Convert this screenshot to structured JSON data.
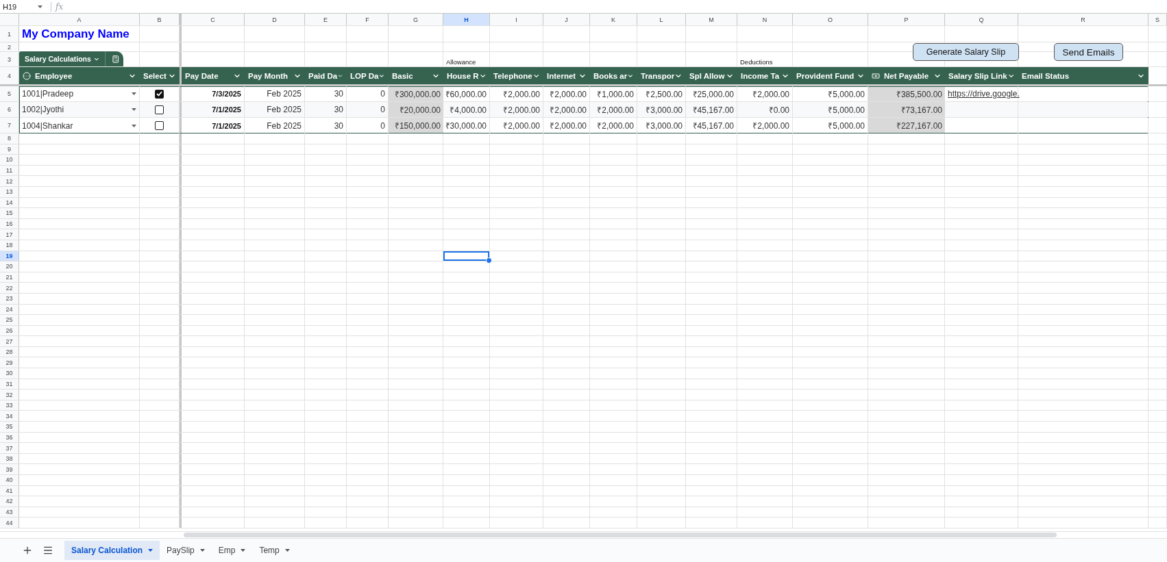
{
  "formula_bar": {
    "name_box": "H19",
    "function_label": "fx"
  },
  "column_letters": [
    {
      "letter": "A",
      "selected": false
    },
    {
      "letter": "B",
      "selected": false
    },
    {
      "letter": "C",
      "selected": false
    },
    {
      "letter": "D",
      "selected": false
    },
    {
      "letter": "E",
      "selected": false
    },
    {
      "letter": "F",
      "selected": false
    },
    {
      "letter": "G",
      "selected": false
    },
    {
      "letter": "H",
      "selected": true
    },
    {
      "letter": "I",
      "selected": false
    },
    {
      "letter": "J",
      "selected": false
    },
    {
      "letter": "K",
      "selected": false
    },
    {
      "letter": "L",
      "selected": false
    },
    {
      "letter": "M",
      "selected": false
    },
    {
      "letter": "N",
      "selected": false
    },
    {
      "letter": "O",
      "selected": false
    },
    {
      "letter": "P",
      "selected": false
    },
    {
      "letter": "Q",
      "selected": false
    },
    {
      "letter": "R",
      "selected": false
    },
    {
      "letter": "S",
      "selected": false
    }
  ],
  "row_numbers": [
    {
      "number": "1",
      "selected": false
    },
    {
      "number": "2",
      "selected": false
    },
    {
      "number": "3",
      "selected": false
    },
    {
      "number": "4",
      "selected": false
    },
    {
      "number": "5",
      "selected": false
    },
    {
      "number": "6",
      "selected": false
    },
    {
      "number": "7",
      "selected": false
    },
    {
      "number": "8",
      "selected": false
    },
    {
      "number": "9",
      "selected": false
    },
    {
      "number": "10",
      "selected": false
    },
    {
      "number": "11",
      "selected": false
    },
    {
      "number": "12",
      "selected": false
    },
    {
      "number": "13",
      "selected": false
    },
    {
      "number": "14",
      "selected": false
    },
    {
      "number": "15",
      "selected": false
    },
    {
      "number": "16",
      "selected": false
    },
    {
      "number": "17",
      "selected": false
    },
    {
      "number": "18",
      "selected": false
    },
    {
      "number": "19",
      "selected": true
    },
    {
      "number": "20",
      "selected": false
    },
    {
      "number": "21",
      "selected": false
    },
    {
      "number": "22",
      "selected": false
    },
    {
      "number": "23",
      "selected": false
    },
    {
      "number": "24",
      "selected": false
    },
    {
      "number": "25",
      "selected": false
    },
    {
      "number": "26",
      "selected": false
    },
    {
      "number": "27",
      "selected": false
    },
    {
      "number": "28",
      "selected": false
    },
    {
      "number": "29",
      "selected": false
    },
    {
      "number": "30",
      "selected": false
    },
    {
      "number": "31",
      "selected": false
    },
    {
      "number": "32",
      "selected": false
    },
    {
      "number": "33",
      "selected": false
    },
    {
      "number": "34",
      "selected": false
    },
    {
      "number": "35",
      "selected": false
    },
    {
      "number": "36",
      "selected": false
    },
    {
      "number": "37",
      "selected": false
    },
    {
      "number": "38",
      "selected": false
    },
    {
      "number": "39",
      "selected": false
    },
    {
      "number": "40",
      "selected": false
    },
    {
      "number": "41",
      "selected": false
    },
    {
      "number": "42",
      "selected": false
    },
    {
      "number": "43",
      "selected": false
    },
    {
      "number": "44",
      "selected": false
    }
  ],
  "title": "My Company Name",
  "buttons": [
    {
      "label": "Generate Salary Slip"
    },
    {
      "label": "Send Emails"
    }
  ],
  "table": {
    "name": "Salary Calculations",
    "columns": [
      {
        "label": "Employee",
        "kind": "dropdown",
        "shaded": false
      },
      {
        "label": "Select",
        "kind": "checkbox",
        "shaded": false
      },
      {
        "label": "Pay Date",
        "kind": "date",
        "shaded": false
      },
      {
        "label": "Pay Month",
        "kind": "value",
        "shaded": false
      },
      {
        "label": "Paid Da",
        "kind": "value",
        "shaded": false
      },
      {
        "label": "LOP Da",
        "kind": "value",
        "shaded": false
      },
      {
        "label": "Basic",
        "kind": "value",
        "shaded": true
      },
      {
        "label": "House R",
        "kind": "value",
        "shaded": false,
        "section": "Allowance"
      },
      {
        "label": "Telephone",
        "kind": "value",
        "shaded": false
      },
      {
        "label": "Internet",
        "kind": "value",
        "shaded": false
      },
      {
        "label": "Books ar",
        "kind": "value",
        "shaded": false
      },
      {
        "label": "Transpor",
        "kind": "value",
        "shaded": false
      },
      {
        "label": "Spl Allow",
        "kind": "value",
        "shaded": false
      },
      {
        "label": "Income Ta",
        "kind": "value",
        "shaded": false,
        "section": "Deductions"
      },
      {
        "label": "Provident Fund",
        "kind": "value",
        "shaded": false
      },
      {
        "label": "Net Payable",
        "kind": "total",
        "shaded": true
      },
      {
        "label": "Salary Slip Link",
        "kind": "link",
        "shaded": false
      },
      {
        "label": "Email Status",
        "kind": "text",
        "shaded": false
      }
    ],
    "rows": [
      {
        "employee": "1001|Pradeep",
        "checked": true,
        "values": [
          "7/3/2025",
          "Feb 2025",
          "30",
          "0",
          "₹300,000.00",
          "₹60,000.00",
          "₹2,000.00",
          "₹2,000.00",
          "₹1,000.00",
          "₹2,500.00",
          "₹25,000.00",
          "₹2,000.00",
          "₹5,000.00",
          "₹385,500.00",
          "https://drive.google."
        ]
      },
      {
        "employee": "1002|Jyothi",
        "checked": false,
        "values": [
          "7/1/2025",
          "Feb 2025",
          "30",
          "0",
          "₹20,000.00",
          "₹4,000.00",
          "₹2,000.00",
          "₹2,000.00",
          "₹2,000.00",
          "₹3,000.00",
          "₹45,167.00",
          "₹0.00",
          "₹5,000.00",
          "₹73,167.00"
        ]
      },
      {
        "employee": "1004|Shankar",
        "checked": false,
        "values": [
          "7/1/2025",
          "Feb 2025",
          "30",
          "0",
          "₹150,000.00",
          "₹30,000.00",
          "₹2,000.00",
          "₹2,000.00",
          "₹2,000.00",
          "₹3,000.00",
          "₹45,167.00",
          "₹2,000.00",
          "₹5,000.00",
          "₹227,167.00"
        ]
      }
    ]
  },
  "sheet_tabs": [
    {
      "label": "Salary Calculation",
      "selected": true
    },
    {
      "label": "PaySlip",
      "selected": false
    },
    {
      "label": "Emp",
      "selected": false
    },
    {
      "label": "Temp",
      "selected": false
    }
  ]
}
